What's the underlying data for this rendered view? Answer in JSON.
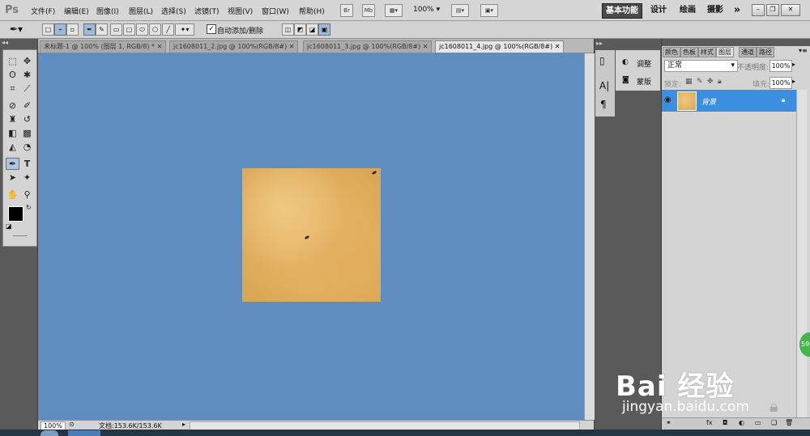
{
  "app": {
    "logo": "Ps"
  },
  "menu": [
    "文件(F)",
    "编辑(E)",
    "图像(I)",
    "图层(L)",
    "选择(S)",
    "滤镜(T)",
    "视图(V)",
    "窗口(W)",
    "帮助(H)"
  ],
  "menubar_buttons": {
    "bridge": "Br",
    "minibridge": "Mb",
    "zoom": "100%"
  },
  "workspaces": {
    "essentials": "基本功能",
    "design": "设计",
    "painting": "绘画",
    "photography": "摄影",
    "more": "»"
  },
  "window_controls": {
    "minimize": "–",
    "restore": "❐",
    "close": "✕"
  },
  "options_bar": {
    "auto_add_delete_label": "自动添加/删除",
    "auto_add_delete_checked": true
  },
  "tabs": [
    {
      "label": "未标题-1 @ 100% (图层 1, RGB/8) *",
      "close": "✕",
      "active": false
    },
    {
      "label": "jc1608011_2.jpg @ 100%(RGB/8#)",
      "close": "✕",
      "active": false
    },
    {
      "label": "jc1608011_3.jpg @ 100%(RGB/8#)",
      "close": "✕",
      "active": false
    },
    {
      "label": "jc1608011_4.jpg @ 100%(RGB/8#)",
      "close": "✕",
      "active": true
    }
  ],
  "status": {
    "zoom": "100%",
    "doc": "文档:153.6K/153.6K"
  },
  "canvas": {
    "background_color": "#5f8dbf"
  },
  "adjust_panel": {
    "adjustments": "调整",
    "masks": "蒙版"
  },
  "layers_panel": {
    "tabs": [
      "颜色",
      "色板",
      "样式",
      "图层",
      "通道",
      "路径"
    ],
    "active_tab": "图层",
    "blend_mode": "正常",
    "opacity_label": "不透明度:",
    "opacity": "100%",
    "lock_label": "锁定:",
    "fill_label": "填充:",
    "fill": "100%",
    "layers": [
      {
        "name": "背景",
        "visible": true,
        "locked": true,
        "selected": true
      }
    ]
  },
  "watermark": {
    "logo": "Bai 经验",
    "url": "jingyan.baidu.com",
    "badge": "59"
  }
}
